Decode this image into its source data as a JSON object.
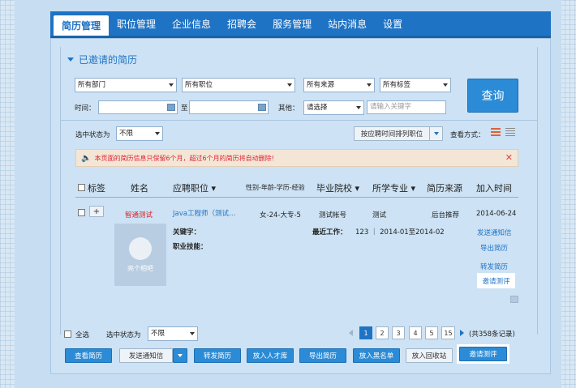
{
  "nav": {
    "tabs": [
      "简历管理",
      "职位管理",
      "企业信息",
      "招聘会",
      "服务管理",
      "站内消息",
      "设置"
    ],
    "active": 0
  },
  "section_title": "已邀请的简历",
  "filters": {
    "dept": "所有部门",
    "position": "所有职位",
    "source": "所有来源",
    "tag": "所有标签",
    "time_label": "时间：",
    "to": "至",
    "other_label": "其他：",
    "other_select": "请选择",
    "keyword_placeholder": "请输入关键字",
    "query_button": "查询"
  },
  "status_row": {
    "label": "选中状态为",
    "status": "不限",
    "sort": "按应聘时间排列职位",
    "view_label": "查看方式："
  },
  "notice": "本页面的简历信息只保留6个月，超过6个月的简历将自动删除!",
  "table": {
    "headers": [
      "标签",
      "姓名",
      "应聘职位",
      "性别-年龄-学历-经验",
      "毕业院校",
      "所学专业",
      "简历来源",
      "加入时间"
    ],
    "row": {
      "name": "智通测试",
      "position": "Java工程师（测试…",
      "info": "女-24-大专-5",
      "school": "测试帐号",
      "major": "测试",
      "source": "后台推荐",
      "date": "2014-06-24",
      "keyword_label": "关键字：",
      "skill_label": "职业技能：",
      "recent_label": "最近工作：",
      "recent_value": "123 ｜ 2014-01至2014-02",
      "photo_caption": "亮个相吧"
    },
    "actions": [
      "发送通知信",
      "导出简历",
      "转发简历",
      "邀请测评"
    ]
  },
  "bottom": {
    "select_all": "全选",
    "status_label": "选中状态为",
    "status": "不限",
    "pages": [
      "1",
      "2",
      "3",
      "4",
      "5",
      "15"
    ],
    "total": "(共358条记录)",
    "buttons": [
      "查看简历",
      "发送通知信",
      "转发简历",
      "放入人才库",
      "导出简历",
      "放入黑名单",
      "放入回收站",
      "邀请测评"
    ]
  },
  "colors": {
    "primary": "#1f73c4",
    "alert": "#d23333"
  }
}
